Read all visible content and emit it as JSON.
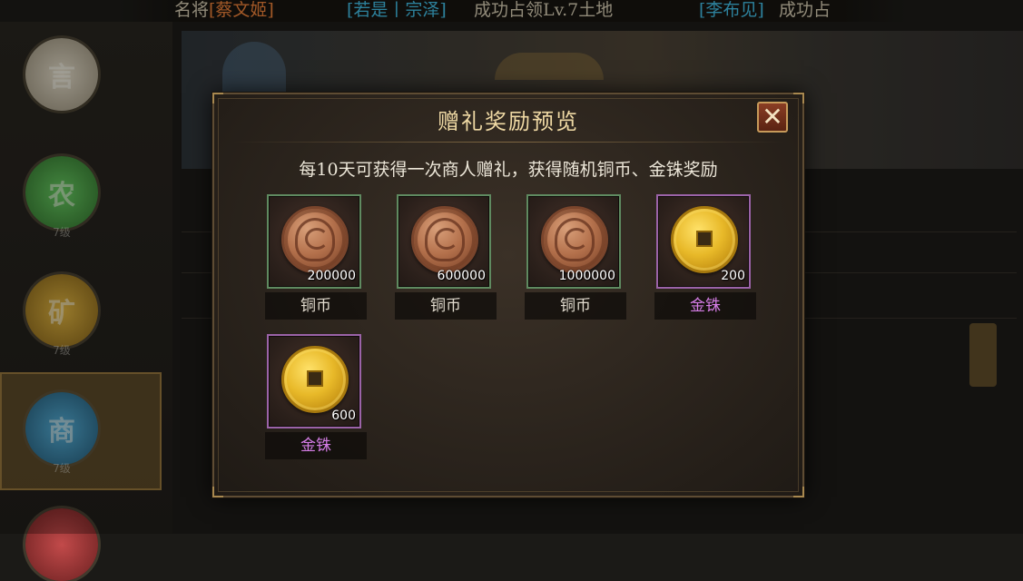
{
  "ticker": {
    "segment1_prefix": "名将",
    "segment1_name": "[蔡文姬]",
    "segment2_name": "[若是丨宗泽]",
    "segment2_text": "成功占领Lv.7土地",
    "segment3_name": "[李布见]",
    "segment3_text": "成功占"
  },
  "background": {
    "side_buttons": [
      {
        "glyph": "言",
        "level": ""
      },
      {
        "glyph": "农",
        "level": "7级"
      },
      {
        "glyph": "矿",
        "level": "7级"
      },
      {
        "glyph": "商",
        "level": "7级"
      }
    ]
  },
  "dialog": {
    "title": "赠礼奖励预览",
    "close_symbol": "✕",
    "description": "每10天可获得一次商人赠礼，获得随机铜币、金铢奖励",
    "items": [
      {
        "name": "铜币",
        "quantity": "200000",
        "type": "copper",
        "rarity": "green"
      },
      {
        "name": "铜币",
        "quantity": "600000",
        "type": "copper",
        "rarity": "green"
      },
      {
        "name": "铜币",
        "quantity": "1000000",
        "type": "copper",
        "rarity": "green"
      },
      {
        "name": "金铢",
        "quantity": "200",
        "type": "gold",
        "rarity": "purple"
      },
      {
        "name": "金铢",
        "quantity": "600",
        "type": "gold",
        "rarity": "purple"
      }
    ]
  },
  "colors": {
    "title": "#efd9a4",
    "green_border": "#5f8a60",
    "purple_border": "#9b63a8",
    "purple_text": "#d57de6",
    "highlight_orange": "#e07a36",
    "highlight_cyan": "#3fb3d8"
  }
}
